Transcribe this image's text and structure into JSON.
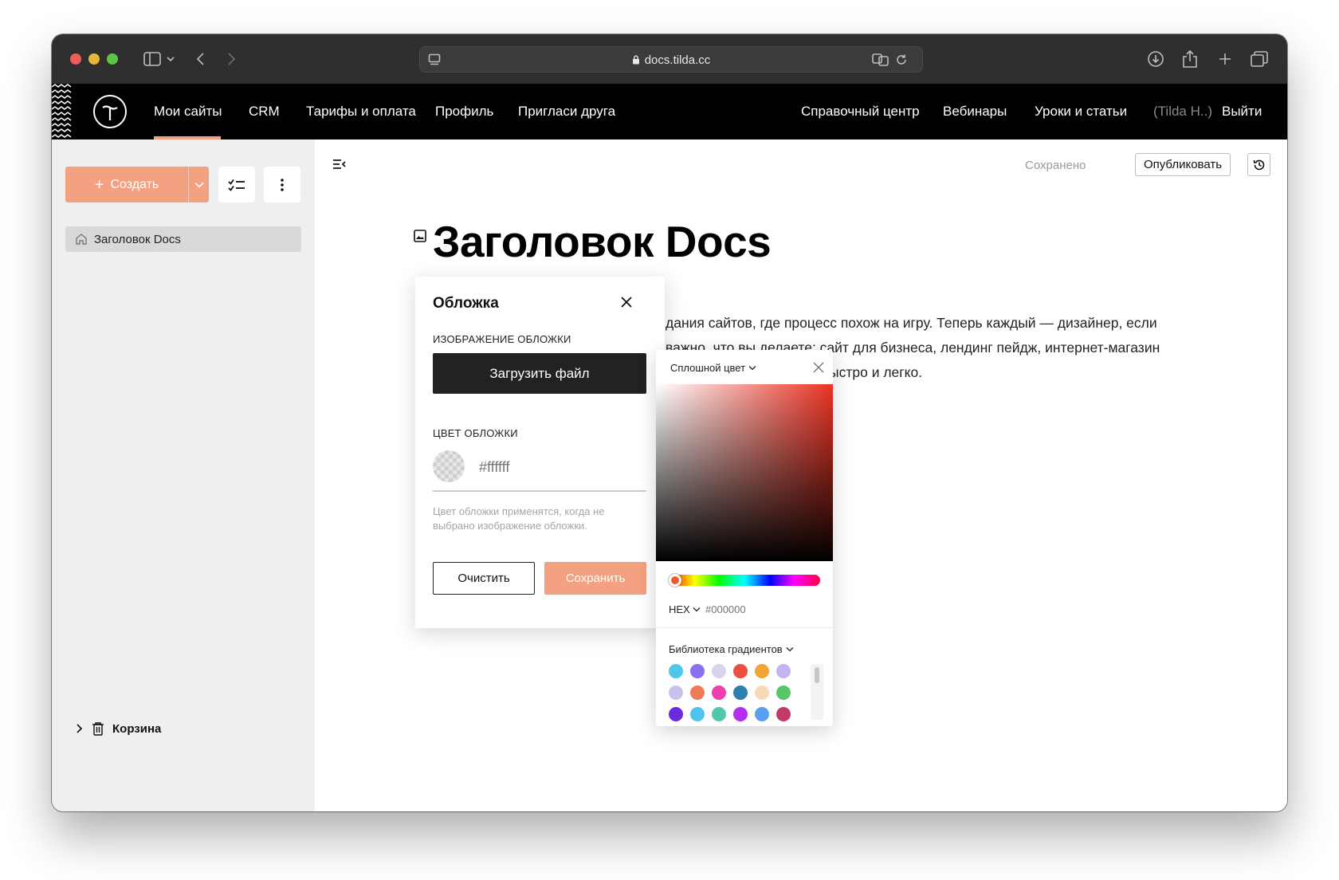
{
  "browser": {
    "url": "docs.tilda.cc"
  },
  "tilda_nav": {
    "left": [
      "Мои сайты",
      "CRM",
      "Тарифы и оплата",
      "Профиль",
      "Пригласи друга"
    ],
    "right": [
      "Справочный центр",
      "Вебинары",
      "Уроки и статьи"
    ],
    "user": "(Tilda H..)",
    "logout": "Выйти"
  },
  "sidebar": {
    "create_label": "Создать",
    "pages": [
      "Заголовок Docs"
    ],
    "trash_label": "Корзина"
  },
  "editor": {
    "status": "Сохранено",
    "publish_label": "Опубликовать",
    "doc_title": "Заголовок Docs",
    "body_lines": [
      "дания сайтов, где процесс похож на игру. Теперь каждый — дизайнер, если",
      "важно, что вы делаете: сайт для бизнеса, лендинг пейдж, интернет-магазин",
      "быстро и легко."
    ]
  },
  "cover_dialog": {
    "title": "Обложка",
    "image_label": "ИЗОБРАЖЕНИЕ ОБЛОЖКИ",
    "upload_label": "Загрузить файл",
    "color_label": "ЦВЕТ ОБЛОЖКИ",
    "color_placeholder": "#ffffff",
    "hint": "Цвет обложки применятся, когда не выбрано изображение обложки.",
    "clear_label": "Очистить",
    "save_label": "Сохранить"
  },
  "color_picker": {
    "mode": "Сплошной цвет",
    "format": "HEX",
    "hex_placeholder": "#000000",
    "library_label": "Библиотека градиентов",
    "swatches": [
      "#4fc7e8",
      "#8a6ff0",
      "#d8d4ec",
      "#ec4f3f",
      "#f0a535",
      "#c3b3f2",
      "#c9c2ee",
      "#f07a5c",
      "#ef3fb0",
      "#2f7fb0",
      "#f6d9b8",
      "#5ac46a",
      "#6b2be0",
      "#4fc3f0",
      "#52c8a8",
      "#b32ff0",
      "#5a9ef0",
      "#c23a6a"
    ]
  },
  "colors": {
    "accent": "#f4a181",
    "header_bg": "#000000",
    "sidebar_bg": "#efefef"
  }
}
